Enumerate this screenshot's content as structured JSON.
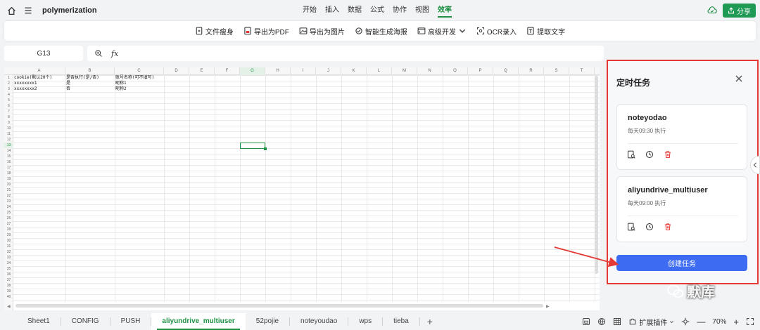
{
  "topbar": {
    "doc_title": "polymerization",
    "menu": [
      "开始",
      "插入",
      "数据",
      "公式",
      "协作",
      "视图",
      "效率"
    ],
    "active_menu": "效率",
    "share_label": "分享"
  },
  "toolbar": {
    "items": [
      {
        "label": "文件瘦身",
        "icon": "file-slim-icon"
      },
      {
        "label": "导出为PDF",
        "icon": "pdf-export-icon"
      },
      {
        "label": "导出为图片",
        "icon": "image-export-icon"
      },
      {
        "label": "智能生成海报",
        "icon": "poster-icon"
      },
      {
        "label": "高级开发",
        "icon": "dev-icon"
      },
      {
        "label": "OCR录入",
        "icon": "ocr-icon"
      },
      {
        "label": "提取文字",
        "icon": "extract-text-icon"
      }
    ]
  },
  "formula_bar": {
    "cell_ref": "G13",
    "fx_label": "fx",
    "value": ""
  },
  "sheet": {
    "columns": [
      "A",
      "B",
      "C",
      "D",
      "E",
      "F",
      "G",
      "H",
      "I",
      "J",
      "K",
      "L",
      "M",
      "N",
      "O",
      "P",
      "Q",
      "R",
      "S",
      "T"
    ],
    "rows": [
      "1",
      "2",
      "3",
      "4",
      "5",
      "6",
      "7",
      "8",
      "9",
      "10",
      "11",
      "12",
      "13",
      "14",
      "15",
      "16",
      "17",
      "18",
      "19",
      "20",
      "21",
      "22",
      "23",
      "24",
      "25",
      "26",
      "27",
      "28",
      "29",
      "30",
      "31",
      "32",
      "33",
      "34",
      "35",
      "36",
      "37",
      "38",
      "39",
      "40"
    ],
    "cells": {
      "A1": "cookie(默认20个)",
      "B1": "是否执行(是/否)",
      "C1": "账号名称(可不填写)",
      "A2": "xxxxxxxx1",
      "B2": "是",
      "C2": "昵称1",
      "A3": "xxxxxxxx2",
      "B3": "否",
      "C3": "昵称2"
    },
    "selected_cell": "G13"
  },
  "panel": {
    "title": "定时任务",
    "tasks": [
      {
        "name": "noteyodao",
        "schedule": "每天09:30 执行"
      },
      {
        "name": "aliyundrive_multiuser",
        "schedule": "每天09:00 执行"
      }
    ],
    "create_label": "创建任务"
  },
  "tabs": [
    "Sheet1",
    "CONFIG",
    "PUSH",
    "aliyundrive_multiuser",
    "52pojie",
    "noteyoudao",
    "wps",
    "tieba"
  ],
  "active_tab": "aliyundrive_multiuser",
  "statusbar": {
    "extensions_label": "扩展插件",
    "zoom": "70%"
  },
  "watermark": "默库",
  "colors": {
    "accent_green": "#1e8f43",
    "primary_blue": "#3d6cf2",
    "annotation_red": "#e53935",
    "delete_red": "#e53935"
  }
}
